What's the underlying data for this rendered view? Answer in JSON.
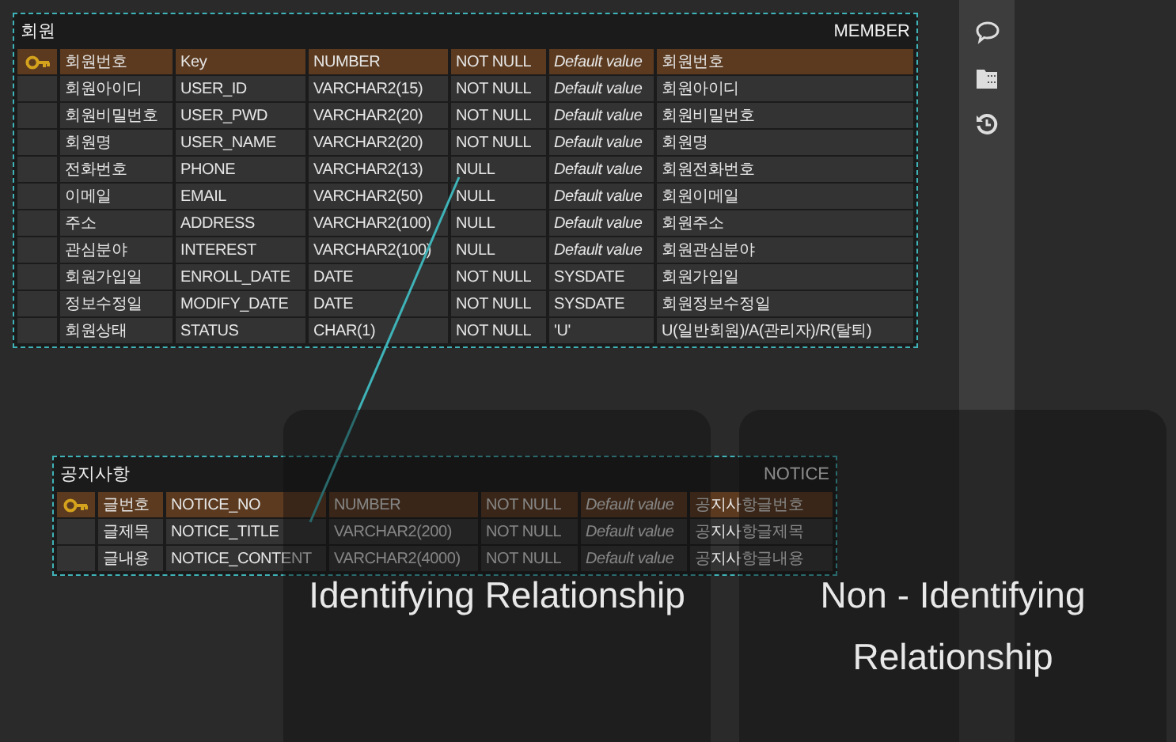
{
  "tables": [
    {
      "name": "회원",
      "physical_name": "MEMBER",
      "rows": [
        {
          "primary_key": true,
          "name": "회원번호",
          "column": "Key",
          "type": "NUMBER",
          "nullability": "NOT NULL",
          "placeholder": "Default value",
          "comment": "회원번호"
        },
        {
          "primary_key": false,
          "name": "회원아이디",
          "column": "USER_ID",
          "type": "VARCHAR2(15)",
          "nullability": "NOT NULL",
          "placeholder": "Default value",
          "comment": "회원아이디"
        },
        {
          "primary_key": false,
          "name": "회원비밀번호",
          "column": "USER_PWD",
          "type": "VARCHAR2(20)",
          "nullability": "NOT NULL",
          "placeholder": "Default value",
          "comment": "회원비밀번호"
        },
        {
          "primary_key": false,
          "name": "회원명",
          "column": "USER_NAME",
          "type": "VARCHAR2(20)",
          "nullability": "NOT NULL",
          "placeholder": "Default value",
          "comment": "회원명"
        },
        {
          "primary_key": false,
          "name": "전화번호",
          "column": "PHONE",
          "type": "VARCHAR2(13)",
          "nullability": "NULL",
          "placeholder": "Default value",
          "comment": "회원전화번호"
        },
        {
          "primary_key": false,
          "name": "이메일",
          "column": "EMAIL",
          "type": "VARCHAR2(50)",
          "nullability": "NULL",
          "placeholder": "Default value",
          "comment": "회원이메일"
        },
        {
          "primary_key": false,
          "name": "주소",
          "column": "ADDRESS",
          "type": "VARCHAR2(100)",
          "nullability": "NULL",
          "placeholder": "Default value",
          "comment": "회원주소"
        },
        {
          "primary_key": false,
          "name": "관심분야",
          "column": "INTEREST",
          "type": "VARCHAR2(100)",
          "nullability": "NULL",
          "placeholder": "Default value",
          "comment": "회원관심분야"
        },
        {
          "primary_key": false,
          "name": "회원가입일",
          "column": "ENROLL_DATE",
          "type": "DATE",
          "nullability": "NOT NULL",
          "default": "SYSDATE",
          "comment": "회원가입일"
        },
        {
          "primary_key": false,
          "name": "정보수정일",
          "column": "MODIFY_DATE",
          "type": "DATE",
          "nullability": "NOT NULL",
          "default": "SYSDATE",
          "comment": "회원정보수정일"
        },
        {
          "primary_key": false,
          "name": "회원상태",
          "column": "STATUS",
          "type": "CHAR(1)",
          "nullability": "NOT NULL",
          "default": "'U'",
          "comment": "U(일반회원)/A(관리자)/R(탈퇴)"
        }
      ]
    },
    {
      "name": "공지사항",
      "physical_name": "NOTICE",
      "rows": [
        {
          "primary_key": true,
          "name": "글번호",
          "column": "NOTICE_NO",
          "type": "NUMBER",
          "nullability": "NOT NULL",
          "placeholder": "Default value",
          "comment": "공지사항글번호"
        },
        {
          "primary_key": false,
          "name": "글제목",
          "column": "NOTICE_TITLE",
          "type": "VARCHAR2(200)",
          "nullability": "NOT NULL",
          "placeholder": "Default value",
          "comment": "공지사항글제목"
        },
        {
          "primary_key": false,
          "name": "글내용",
          "column": "NOTICE_CONTENT",
          "type": "VARCHAR2(4000)",
          "nullability": "NOT NULL",
          "placeholder": "Default value",
          "comment": "공지사항글내용"
        }
      ]
    }
  ],
  "overlays": [
    {
      "label": "Identifying Relationship"
    },
    {
      "label": "Non - Identifying Relationship"
    }
  ]
}
